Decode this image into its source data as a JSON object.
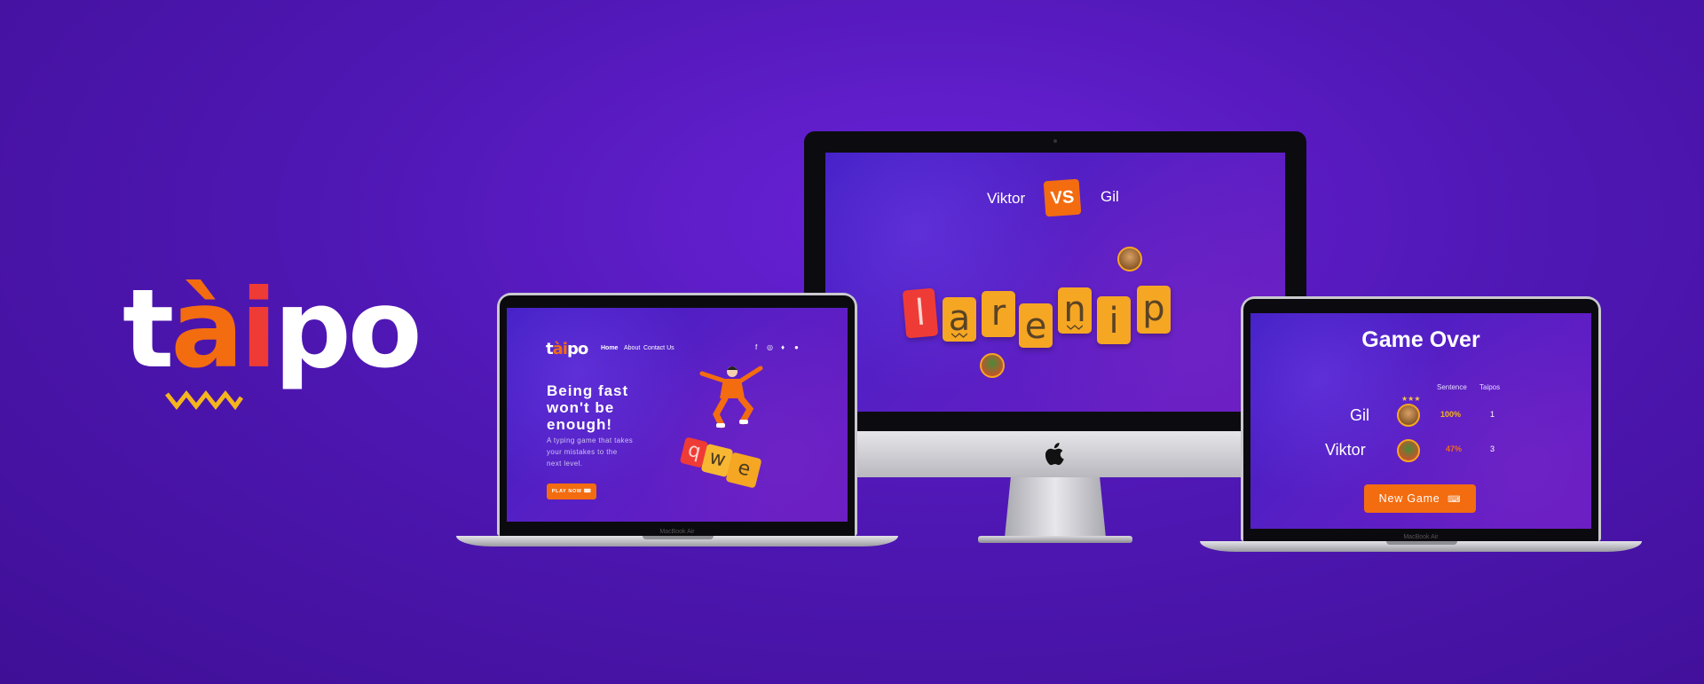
{
  "brand": {
    "logo_parts": [
      "t",
      "à",
      "i",
      "po"
    ],
    "colors": {
      "white": "#ffffff",
      "orange": "#f36c10",
      "red": "#ef3b36",
      "yellow": "#f5a623",
      "purple": "#5a1fc4"
    }
  },
  "landing": {
    "logo_parts": [
      "t",
      "ài",
      "po"
    ],
    "nav": [
      "Home",
      "About",
      "Contact Us"
    ],
    "social_icons": [
      "facebook-icon",
      "instagram-icon",
      "twitter-icon",
      "github-icon"
    ],
    "hero_title": [
      "Being fast",
      "won't be",
      "enough!"
    ],
    "hero_subtitle": [
      "A typing game that takes",
      "your mistakes to the",
      "next level."
    ],
    "play_button": "PLAY NOW",
    "tiles": [
      "q",
      "w",
      "e"
    ],
    "device_label": "MacBook Air"
  },
  "match": {
    "player_left": "Viktor",
    "vs": "VS",
    "player_right": "Gil",
    "letters": [
      "l",
      "a",
      "r",
      "e",
      "n",
      "i",
      "p"
    ]
  },
  "game_over": {
    "title": "Game Over",
    "headers": [
      "Sentence",
      "Taipos"
    ],
    "rows": [
      {
        "name": "Gil",
        "sentence": "100%",
        "taipos": "1"
      },
      {
        "name": "Viktor",
        "sentence": "47%",
        "taipos": "3"
      }
    ],
    "button": "New Game",
    "device_label": "MacBook Air"
  }
}
